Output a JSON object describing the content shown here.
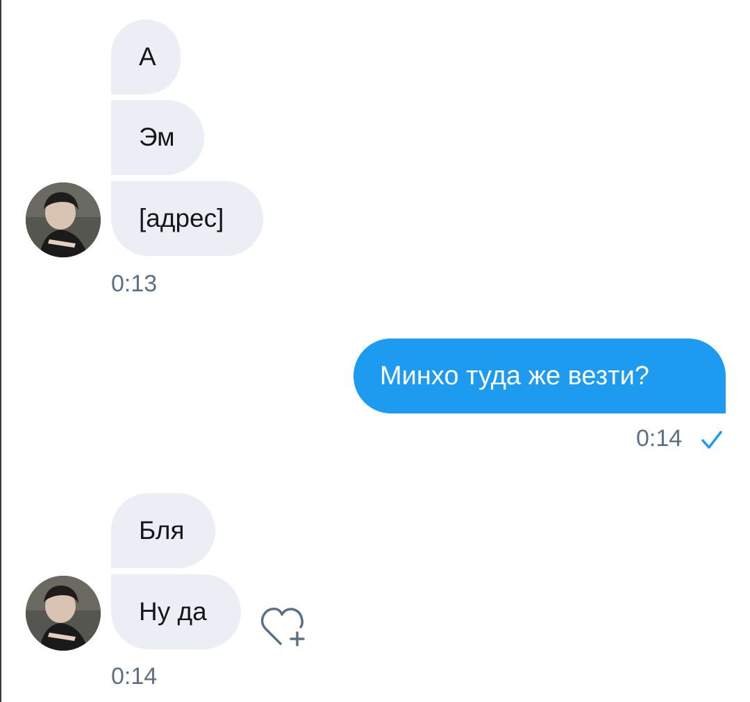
{
  "conversation": {
    "group1": {
      "messages": [
        "А",
        "Эм",
        "[адрес]"
      ],
      "time": "0:13"
    },
    "outgoing": {
      "message": "Минхо туда же везти?",
      "time": "0:14",
      "status_icon": "checkmark-icon"
    },
    "group2": {
      "messages": [
        "Бля",
        "Ну да"
      ],
      "time": "0:14",
      "reaction_icon": "heart-plus-icon"
    }
  },
  "colors": {
    "incoming_bubble": "#eceef5",
    "outgoing_bubble": "#1d9bf0",
    "timestamp": "#5b7083",
    "accent": "#1d9bf0"
  }
}
